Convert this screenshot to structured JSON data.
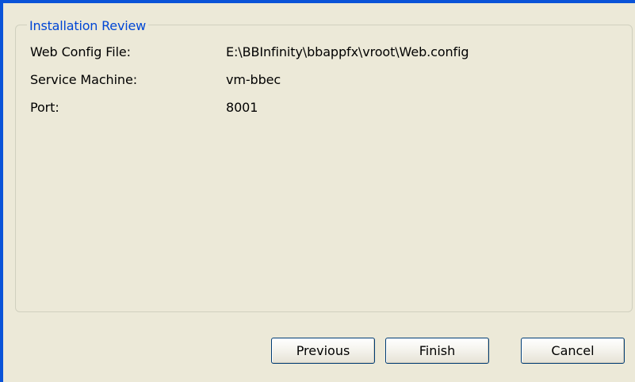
{
  "review": {
    "title": "Installation Review",
    "rows": [
      {
        "label": "Web Config File:",
        "value": "E:\\BBInfinity\\bbappfx\\vroot\\Web.config"
      },
      {
        "label": "Service Machine:",
        "value": "vm-bbec"
      },
      {
        "label": "Port:",
        "value": "8001"
      }
    ]
  },
  "buttons": {
    "previous": "Previous",
    "finish": "Finish",
    "cancel": "Cancel"
  },
  "colors": {
    "frame": "#0a53d8",
    "background": "#ece9d8",
    "legend": "#0046d5"
  }
}
